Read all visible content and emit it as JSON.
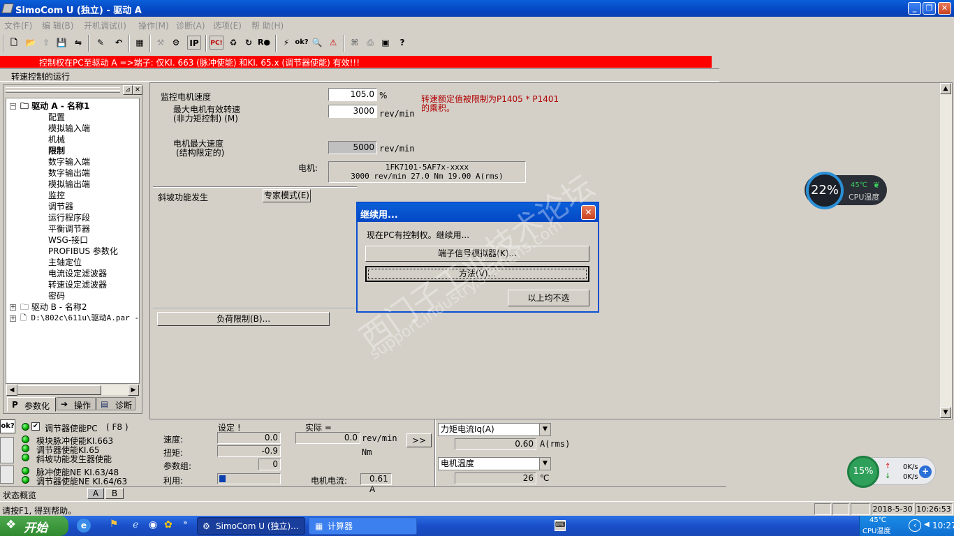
{
  "window": {
    "title": "SimoCom U (独立) - 驱动 A",
    "buttons": {
      "minimize": "_",
      "restore": "❐",
      "close": "✕"
    }
  },
  "menu": [
    "文件(F)",
    "编 辑(B)",
    "开机调试(I)",
    "操作(M)",
    "诊断(A)",
    "选项(E)",
    "帮 助(H)"
  ],
  "toolbar": {
    "ip_label": "IP",
    "pc_label": "PC!",
    "ro_label": "R●",
    "ok_label": "ok?"
  },
  "alert_bar": "控制权在PC至驱动 A =>端子: 仅KI. 663 (脉冲使能) 和KI. 65.x (调节器使能) 有效!!!",
  "mode_line": "转速控制的运行",
  "tree": {
    "drive_a": "驱动 A - 名称1",
    "children": [
      "配置",
      "模拟输入端",
      "机械",
      "限制",
      "数字输入端",
      "数字输出端",
      "模拟输出端",
      "监控",
      "调节器",
      "运行程序段",
      "平衡调节器",
      "WSG-接口",
      "PROFIBUS 参数化",
      "主轴定位",
      "电流设定滤波器",
      "转速设定滤波器",
      "密码"
    ],
    "drive_b": "驱动 B - 名称2",
    "file": "D:\\802c\\611u\\驱动A.par -",
    "tabs": [
      "参数化",
      "操作",
      "诊断"
    ]
  },
  "main": {
    "monitor_speed_label": "监控电机速度",
    "monitor_speed_value": "105.0",
    "monitor_speed_unit": "%",
    "max_speed_label": "最大电机有效转速",
    "max_speed_sub": "(非力矩控制) (M)",
    "max_speed_value": "3000",
    "max_speed_unit": "rev/min",
    "note_line1": "转速额定值被限制为P1405 * P1401",
    "note_line2": "的乘积。",
    "motor_max_label": "电机最大速度",
    "motor_max_sub": "(结构限定的)",
    "motor_max_value": "5000",
    "motor_max_unit": "rev/min",
    "motor_label": "电机:",
    "motor_line1": "1FK7101-5AF7x-xxxx",
    "motor_line2": "3000 rev/min  27.0 Nm 19.00 A(rms)",
    "ramp_label": "斜坡功能发生",
    "expert_button": "专家模式(E)",
    "load_limit_button": "负荷限制(B)..."
  },
  "dialog": {
    "title": "继续用...",
    "message": "现在PC有控制权。继续用...",
    "btn_terminal": "端子信号模拟器(K)...",
    "btn_method": "方法(V)...",
    "btn_none": "以上均不选",
    "close": "✕"
  },
  "watermark": {
    "line1": "西门子工业技术论坛",
    "line2": "support.industry.siemens.com"
  },
  "status": {
    "ok_label": "ok?",
    "regulator_enable_pc": "调节器使能PC",
    "f8": "( F8 )",
    "module_pulse": "模块脉冲使能KI.663",
    "regulator_ki65": "调节器使能KI.65",
    "ramp_enable": "斜坡功能发生器使能",
    "pulse_ne": "脉冲使能NE KI.63/48",
    "regulator_ne": "调节器使能NE KI.64/63",
    "setpoint_header": "设定 !",
    "actual_header": "实际 =",
    "speed_label": "速度:",
    "speed_set": "0.0",
    "speed_actual": "0.0",
    "speed_unit": "rev/min",
    "torque_label": "扭矩:",
    "torque_set": "-0.9",
    "torque_unit": "Nm",
    "paramset_label": "参数组:",
    "paramset_value": "0",
    "util_label": "利用:",
    "util_fraction": 0.1,
    "motor_current_label": "电机电流:",
    "motor_current_value": "0.61",
    "motor_current_unit": "A",
    "more_button": ">>",
    "select1": "力矩电流Iq(A)",
    "select1_value": "0.60",
    "select1_unit": "A(rms)",
    "select2": "电机温度",
    "select2_value": "26",
    "select2_unit": "℃",
    "overview_label": "状态概览",
    "tab_a": "A",
    "tab_b": "B"
  },
  "statusbar": {
    "help": "请按F1, 得到帮助。",
    "date": "2018-5-30",
    "time": "10:26:53"
  },
  "cpu_gauge": {
    "percent": "22%",
    "temp": "45℃",
    "label": "CPU温度"
  },
  "net_gauge": {
    "percent": "15%",
    "up": "0K/s",
    "down": "0K/s"
  },
  "taskbar": {
    "start": "开始",
    "task1": "SimoCom U (独立)...",
    "task2": "计算器",
    "tray_temp": "45℃",
    "tray_label": "CPU温度",
    "clock": "10:27"
  },
  "colors": {
    "alert": "#ff0000",
    "note": "#b00000",
    "titlebar": "#0447c4",
    "taskbar": "#1a4fc8"
  }
}
